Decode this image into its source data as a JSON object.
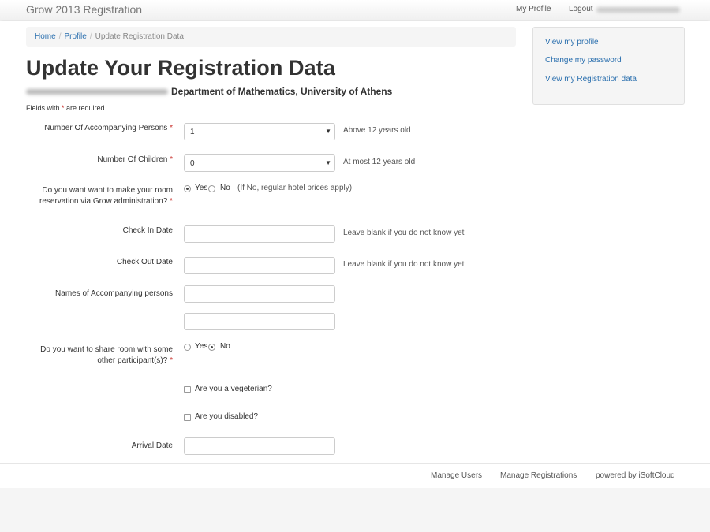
{
  "navbar": {
    "brand": "Grow 2013 Registration",
    "my_profile": "My Profile",
    "logout": "Logout"
  },
  "breadcrumb": {
    "home": "Home",
    "profile": "Profile",
    "current": "Update Registration Data"
  },
  "sidebar": {
    "items": [
      "View my profile",
      "Change my password",
      "View my Registration data"
    ]
  },
  "header": {
    "title": "Update Your Registration Data",
    "subtitle": "Department of Mathematics, University of Athens"
  },
  "required_note": {
    "before": "Fields with ",
    "star": "*",
    "after": " are required."
  },
  "form": {
    "accompanying": {
      "label": "Number Of Accompanying Persons",
      "value": "1",
      "help": "Above 12 years old"
    },
    "children": {
      "label": "Number Of Children",
      "value": "0",
      "help": "At most 12 years old"
    },
    "room_reservation": {
      "label_line1": "Do you want want to make your room",
      "label_line2": "reservation via Grow administration?",
      "yes": "Yes",
      "no": "No",
      "selected": "Yes",
      "help": "(If No, regular hotel prices apply)"
    },
    "check_in": {
      "label": "Check In Date",
      "value": "",
      "help": "Leave blank if you do not know yet"
    },
    "check_out": {
      "label": "Check Out Date",
      "value": "",
      "help": "Leave blank if you do not know yet"
    },
    "names": {
      "label": "Names of Accompanying persons",
      "value1": "",
      "value2": ""
    },
    "share_room": {
      "label_line1": "Do you want to share room with some",
      "label_line2": "other participant(s)?",
      "yes": "Yes",
      "no": "No",
      "selected": "No"
    },
    "vegetarian": {
      "label": "Are you a vegeterian?",
      "checked": false
    },
    "disabled": {
      "label": "Are you disabled?",
      "checked": false
    },
    "arrival": {
      "label": "Arrival Date",
      "value": ""
    }
  },
  "footer": {
    "manage_users": "Manage Users",
    "manage_registrations": "Manage Registrations",
    "powered": "powered by iSoftCloud"
  },
  "colors": {
    "link": "#2a6fae",
    "required_star": "#c9302c"
  }
}
